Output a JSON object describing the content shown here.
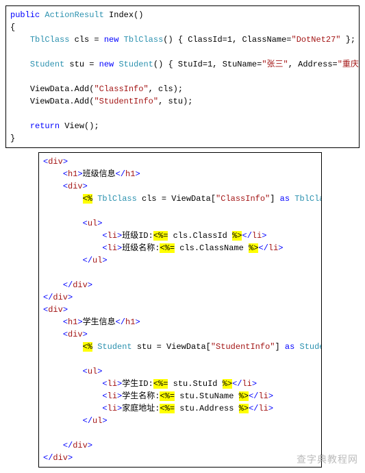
{
  "cs": {
    "kw_public": "public",
    "type_actionresult": "ActionResult",
    "method_name": "Index",
    "paren": "()",
    "obrace": "{",
    "cbrace": "}",
    "indent": "    ",
    "type_tblclass": "TblClass",
    "var_cls": " cls = ",
    "kw_new": "new",
    "ctor_tblclass": " TblClass",
    "init_cls_open": "() { ClassId=1, ClassName=",
    "str_dotnet": "\"DotNet27\"",
    "init_close": " };",
    "type_student": "Student",
    "var_stu": " stu = ",
    "ctor_student": " Student",
    "init_stu_open": "() { StuId=1, StuName=",
    "str_zhangsan": "\"张三\"",
    "comma_addr": ", Address=",
    "str_chongqing": "\"重庆市\"",
    "viewdata_add1a": "ViewData.Add(",
    "str_classinfo": "\"ClassInfo\"",
    "viewdata_add1b": ", cls);",
    "viewdata_add2a": "ViewData.Add(",
    "str_studentinfo": "\"StudentInfo\"",
    "viewdata_add2b": ", stu);",
    "kw_return": "return",
    "return_tail": " View();"
  },
  "aspx": {
    "lt": "<",
    "gt": ">",
    "slash": "/",
    "tag_div": "div",
    "tag_h1": "h1",
    "tag_ul": "ul",
    "tag_li": "li",
    "h1_class": "班级信息",
    "h1_student": "学生信息",
    "open_block": "<%",
    "close_block": "%>",
    "open_expr": "<%=",
    "cls_decl_a": " ",
    "type_tblclass": "TblClass",
    "cls_decl_b": " cls = ViewData[",
    "str_classinfo": "\"ClassInfo\"",
    "cls_decl_c": "] ",
    "kw_as": "as",
    "cls_decl_d": " ",
    "cls_decl_e": "; ",
    "li_classid": "班级ID:",
    "expr_classid": " cls.ClassId ",
    "li_classname": "班级名称:",
    "expr_classname": " cls.ClassName ",
    "stu_decl_b": " stu = ViewData[",
    "type_student": "Student",
    "str_studentinfo": "\"StudentInfo\"",
    "stu_decl_c": "] ",
    "stu_decl_e": "; ",
    "li_stuid": "学生ID:",
    "expr_stuid": " stu.StuId ",
    "li_stuname": "学生名称:",
    "expr_stuname": " stu.StuName ",
    "li_addr": "家庭地址:",
    "expr_addr": " stu.Address "
  },
  "watermark": "查字典教程网"
}
